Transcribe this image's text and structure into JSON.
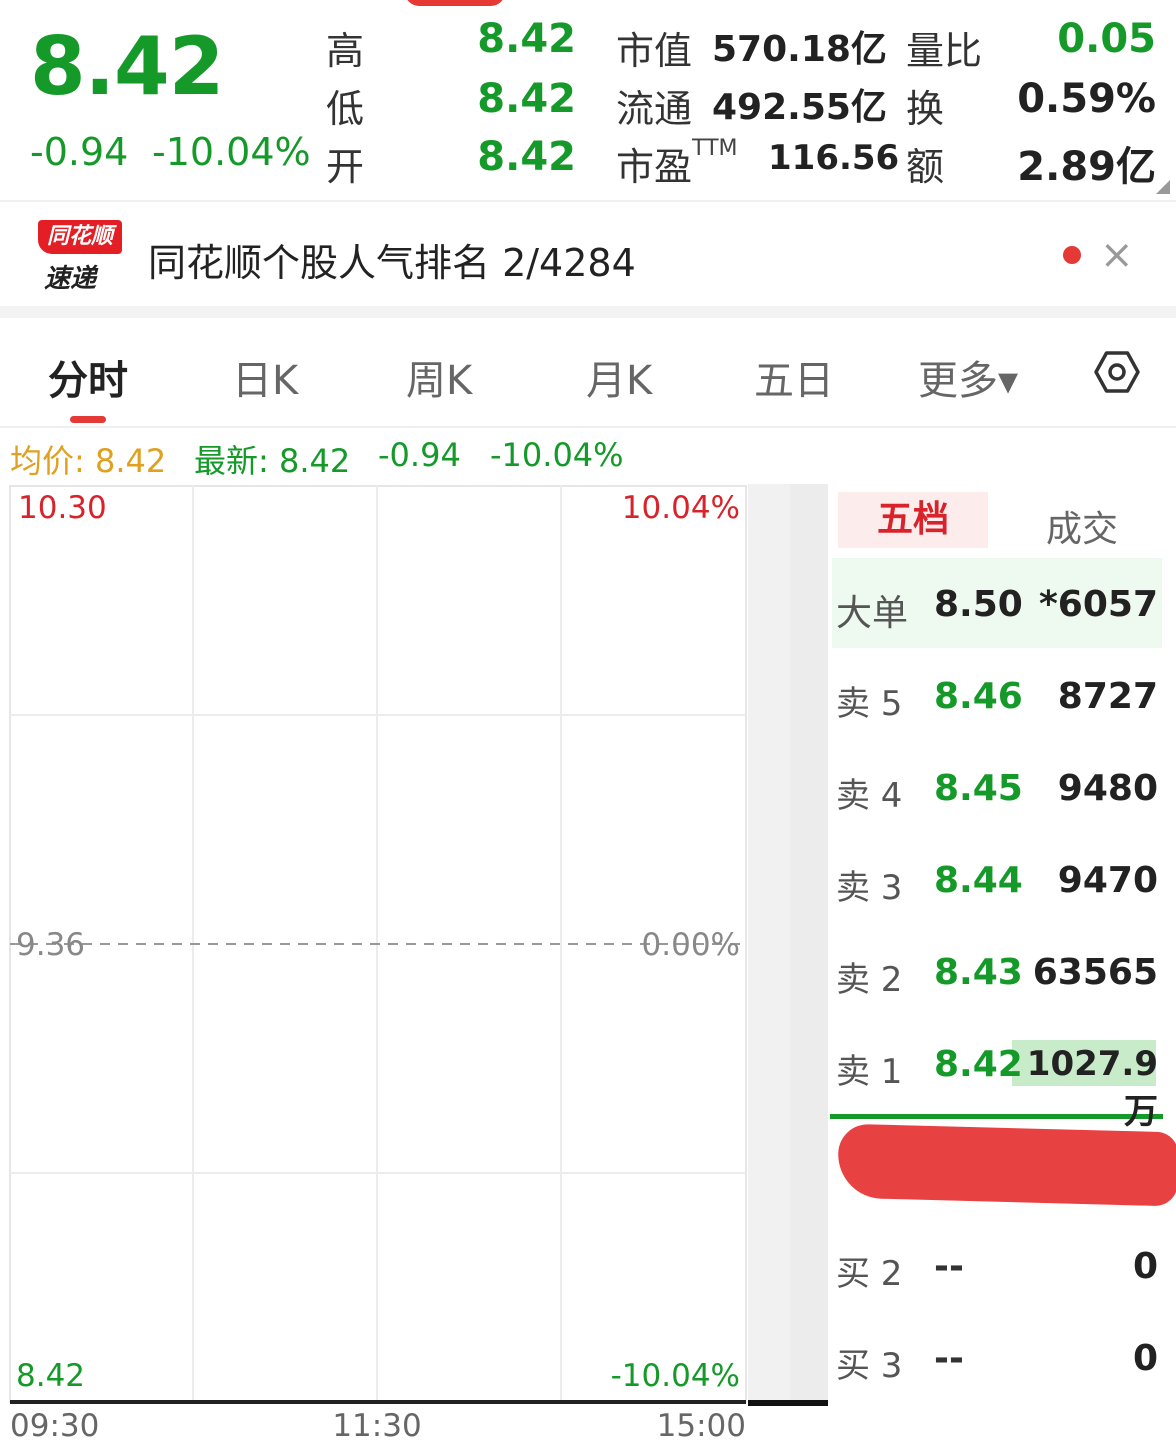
{
  "colors": {
    "up": "#d8232a",
    "down": "#159a2a",
    "avg": "#e0a020",
    "accent": "#e53935"
  },
  "header": {
    "price": "8.42",
    "change": "-0.94",
    "change_pct": "-10.04%",
    "high_label": "高",
    "high": "8.42",
    "low_label": "低",
    "low": "8.42",
    "open_label": "开",
    "open": "8.42",
    "mcap_label": "市值",
    "mcap": "570.18亿",
    "float_label": "流通",
    "float": "492.55亿",
    "pe_label": "市盈",
    "pe_sup": "TTM",
    "pe": "116.56",
    "vr_label": "量比",
    "vr": "0.05",
    "turnover_label": "换",
    "turnover": "0.59%",
    "amount_label": "额",
    "amount": "2.89亿"
  },
  "banner": {
    "logo_top": "同花顺",
    "logo_bottom": "速递",
    "text": "同花顺个股人气排名 2/4284",
    "close_icon": "close-icon"
  },
  "tabs": [
    {
      "label": "分时",
      "active": true
    },
    {
      "label": "日K"
    },
    {
      "label": "周K"
    },
    {
      "label": "月K"
    },
    {
      "label": "五日"
    },
    {
      "label": "更多▾"
    }
  ],
  "info": {
    "avg_label": "均价: 8.42",
    "latest_label": "最新: 8.42",
    "change": "-0.94",
    "change_pct": "-10.04%"
  },
  "chart_data": {
    "type": "line",
    "y_left_ticks": [
      "10.30",
      "9.36",
      "8.42"
    ],
    "y_right_ticks": [
      "10.04%",
      "0.00%",
      "-10.04%"
    ],
    "x_ticks": [
      "09:30",
      "11:30",
      "15:00"
    ],
    "ylim": [
      8.42,
      10.3
    ],
    "prev_close": 9.36,
    "grid": true
  },
  "orderbook": {
    "tab_active": "五档",
    "tab_other": "成交",
    "big_order": {
      "label": "大单",
      "price": "8.50",
      "volume": "*6057"
    },
    "asks": [
      {
        "label": "卖 5",
        "price": "8.46",
        "volume": "8727"
      },
      {
        "label": "卖 4",
        "price": "8.45",
        "volume": "9480"
      },
      {
        "label": "卖 3",
        "price": "8.44",
        "volume": "9470"
      },
      {
        "label": "卖 2",
        "price": "8.43",
        "volume": "63565"
      },
      {
        "label": "卖 1",
        "price": "8.42",
        "volume": "1027.9万"
      }
    ],
    "bids": [
      {
        "label": "买 2",
        "price": "--",
        "volume": "0"
      },
      {
        "label": "买 3",
        "price": "--",
        "volume": "0"
      }
    ]
  }
}
